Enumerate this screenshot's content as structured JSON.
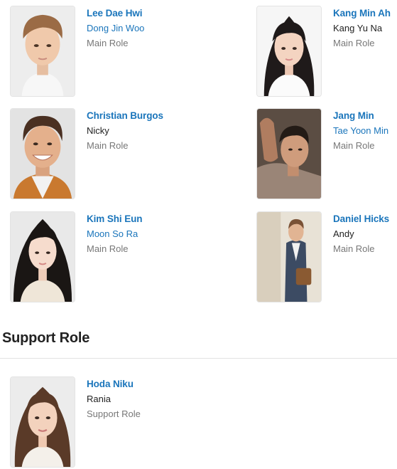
{
  "main_cast": [
    {
      "name": "Lee Dae Hwi",
      "character": "Dong Jin Woo",
      "character_linked": true,
      "role": "Main Role",
      "photo": "lee-dae-hwi-photo"
    },
    {
      "name": "Kang Min Ah",
      "character": "Kang Yu Na",
      "character_linked": false,
      "role": "Main Role",
      "photo": "kang-min-ah-photo"
    },
    {
      "name": "Christian Burgos",
      "character": "Nicky",
      "character_linked": false,
      "role": "Main Role",
      "photo": "christian-burgos-photo"
    },
    {
      "name": "Jang Min",
      "character": "Tae Yoon Min",
      "character_linked": true,
      "role": "Main Role",
      "photo": "jang-min-photo"
    },
    {
      "name": "Kim Shi Eun",
      "character": "Moon So Ra",
      "character_linked": true,
      "role": "Main Role",
      "photo": "kim-shi-eun-photo"
    },
    {
      "name": "Daniel Hicks",
      "character": "Andy",
      "character_linked": false,
      "role": "Main Role",
      "photo": "daniel-hicks-photo"
    }
  ],
  "support_section": {
    "title": "Support Role"
  },
  "support_cast": [
    {
      "name": "Hoda Niku",
      "character": "Rania",
      "character_linked": false,
      "role": "Support Role",
      "photo": "hoda-niku-photo"
    }
  ],
  "colors": {
    "link": "#1a75bb",
    "text": "#222222",
    "muted": "#777777",
    "divider": "#e2e2e2"
  }
}
